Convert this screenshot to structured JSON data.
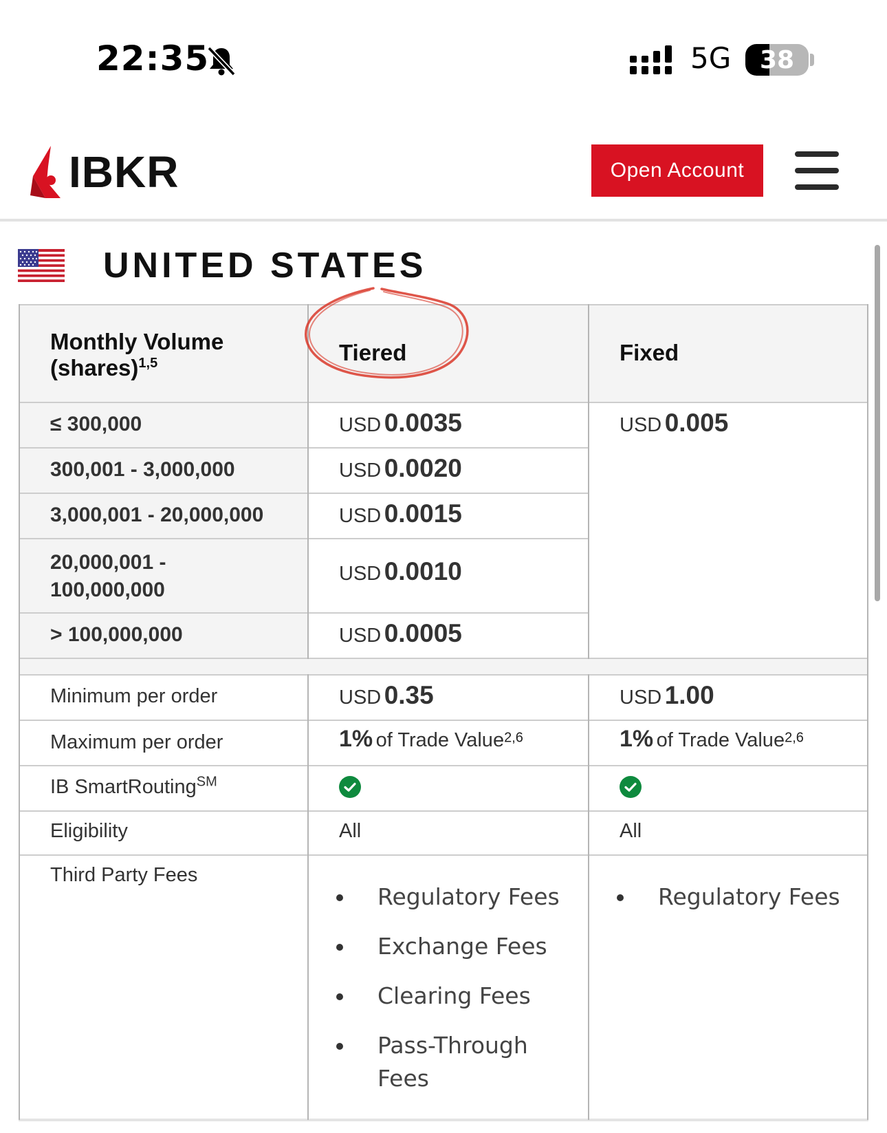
{
  "status_bar": {
    "time": "22:35",
    "network": "5G",
    "battery_level": "38",
    "battery_fraction": 0.38,
    "icons": [
      "bell-slash-icon",
      "signal-bars-icon",
      "battery-icon"
    ]
  },
  "header": {
    "logo_text": "IBKR",
    "open_account_label": "Open Account",
    "brand_color": "#d81222",
    "menu_icon": "hamburger-menu-icon"
  },
  "country": {
    "name": "UNITED STATES",
    "flag_icon": "us-flag-icon"
  },
  "table": {
    "col_volume_header": "Monthly Volume (shares)",
    "col_volume_header_sup": "1,5",
    "col_tiered_header": "Tiered",
    "col_fixed_header": "Fixed",
    "tiers": [
      {
        "volume": "≤ 300,000",
        "currency": "USD",
        "rate": "0.0035"
      },
      {
        "volume": "300,001 - 3,000,000",
        "currency": "USD",
        "rate": "0.0020"
      },
      {
        "volume": "3,000,001 - 20,000,000",
        "currency": "USD",
        "rate": "0.0015"
      },
      {
        "volume": "20,000,001 - 100,000,000",
        "currency": "USD",
        "rate": "0.0010"
      },
      {
        "volume": "> 100,000,000",
        "currency": "USD",
        "rate": "0.0005"
      }
    ],
    "fixed_rate": {
      "currency": "USD",
      "rate": "0.005"
    },
    "minimum": {
      "label": "Minimum per order",
      "tiered_currency": "USD",
      "tiered_value": "0.35",
      "fixed_currency": "USD",
      "fixed_value": "1.00"
    },
    "maximum": {
      "label": "Maximum per order",
      "tiered_pct": "1%",
      "tiered_text": "of Trade Value",
      "tiered_sup": "2,6",
      "fixed_pct": "1%",
      "fixed_text": "of Trade Value",
      "fixed_sup": "2,6"
    },
    "smart_routing": {
      "label": "IB SmartRouting",
      "label_sup": "SM",
      "tiered": true,
      "fixed": true,
      "check_color": "#0e8a3e"
    },
    "eligibility": {
      "label": "Eligibility",
      "tiered": "All",
      "fixed": "All"
    },
    "third_party": {
      "label": "Third Party Fees",
      "tiered": [
        "Regulatory Fees",
        "Exchange Fees",
        "Clearing Fees",
        "Pass-Through Fees"
      ],
      "fixed": [
        "Regulatory Fees"
      ]
    }
  },
  "annotation_color": "#d9382a"
}
